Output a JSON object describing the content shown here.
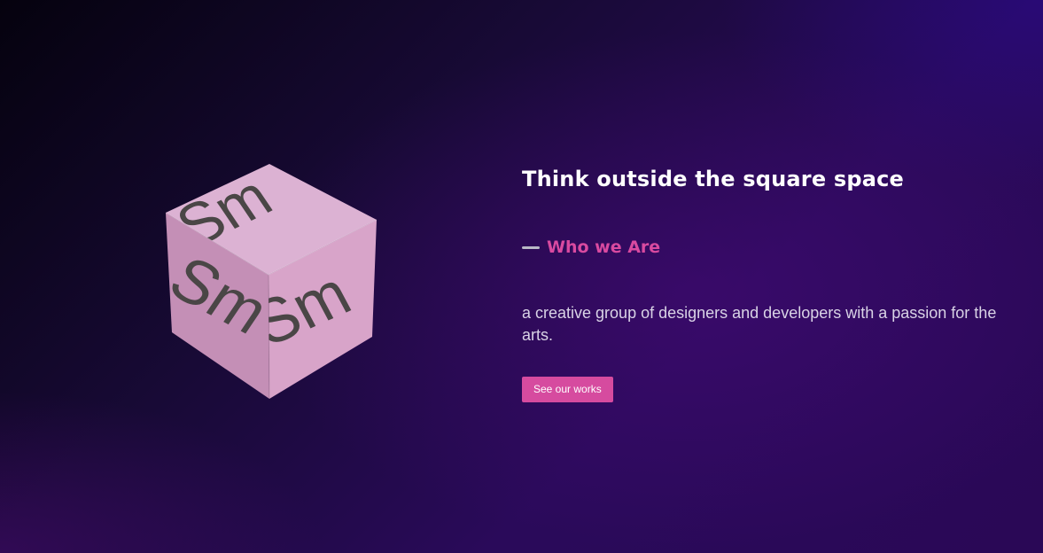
{
  "hero": {
    "title": "Think outside the square space",
    "subhead": "Who we Are",
    "description": "a creative group of designers and developers with a passion for the arts.",
    "cta_label": "See our works"
  },
  "cube": {
    "face_text": "Sm",
    "colors": {
      "top": "#dcb2d3",
      "left": "#c48fb6",
      "right": "#d8a4c9",
      "text": "#4a4646"
    }
  },
  "colors": {
    "accent": "#d64b9f",
    "background_dark": "#05020e",
    "background_purple": "#2a0a5a"
  }
}
